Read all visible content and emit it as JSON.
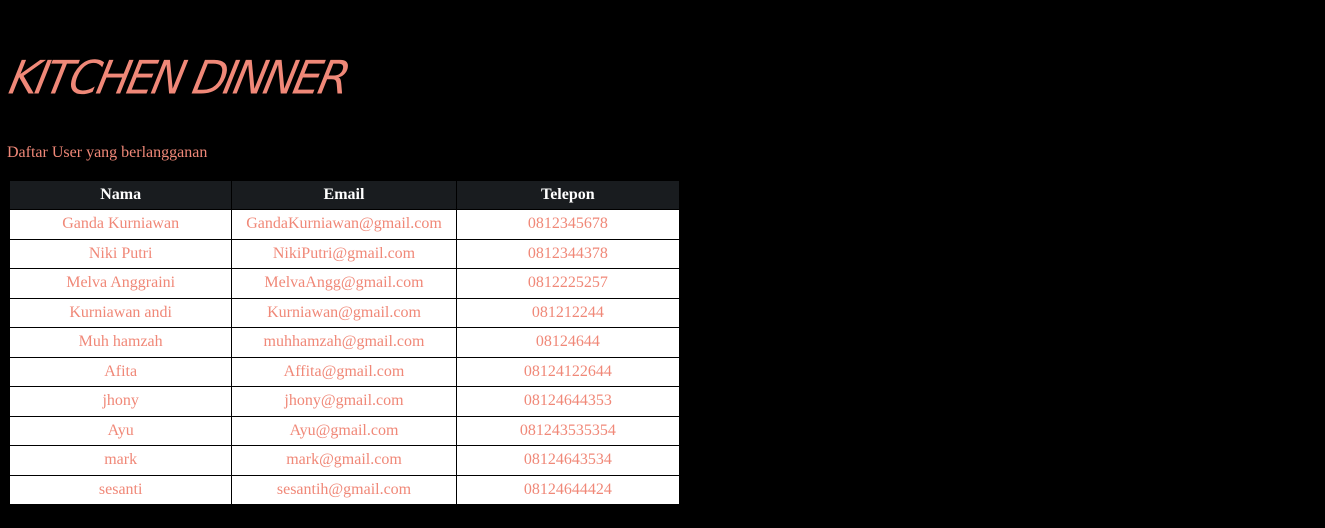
{
  "brand": {
    "name": "KITCHEN DINNER",
    "color": "#f08878"
  },
  "subtitle": "Daftar User yang berlangganan",
  "table": {
    "headers": [
      "Nama",
      "Email",
      "Telepon"
    ],
    "rows": [
      [
        "Ganda Kurniawan",
        "GandaKurniawan@gmail.com",
        "0812345678"
      ],
      [
        "Niki Putri",
        "NikiPutri@gmail.com",
        "0812344378"
      ],
      [
        "Melva Anggraini",
        "MelvaAngg@gmail.com",
        "0812225257"
      ],
      [
        "Kurniawan andi",
        "Kurniawan@gmail.com",
        "081212244"
      ],
      [
        "Muh hamzah",
        "muhhamzah@gmail.com",
        "08124644"
      ],
      [
        "Afita",
        "Affita@gmail.com",
        "08124122644"
      ],
      [
        "jhony",
        "jhony@gmail.com",
        "08124644353"
      ],
      [
        "Ayu",
        "Ayu@gmail.com",
        "081243535354"
      ],
      [
        "mark",
        "mark@gmail.com",
        "08124643534"
      ],
      [
        "sesanti",
        "sesantih@gmail.com",
        "08124644424"
      ]
    ]
  }
}
